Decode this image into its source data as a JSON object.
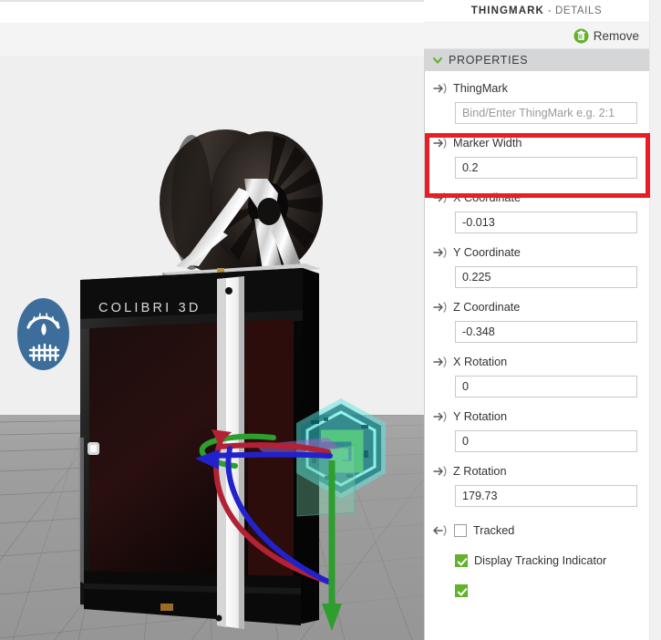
{
  "panel": {
    "title_strong": "THINGMARK",
    "title_sep": " - ",
    "title_light": "DETAILS",
    "remove_label": "Remove",
    "remove_icon": "trash-icon",
    "section": {
      "label": "PROPERTIES",
      "chevron_icon": "chevron-down-icon",
      "expanded": true
    },
    "accent_green": "#62b22c",
    "highlight_color": "#ec1c24",
    "properties": [
      {
        "label": "ThingMark",
        "bind_icon": "arrow-right-binding-icon",
        "value": "",
        "placeholder": "Bind/Enter ThingMark e.g. 2:1",
        "highlighted": false
      },
      {
        "label": "Marker Width",
        "bind_icon": "arrow-right-binding-icon",
        "value": "0.2",
        "placeholder": "",
        "highlighted": true
      },
      {
        "label": "X Coordinate",
        "bind_icon": "arrow-right-binding-icon",
        "value": "-0.013",
        "placeholder": "",
        "highlighted": false
      },
      {
        "label": "Y Coordinate",
        "bind_icon": "arrow-right-binding-icon",
        "value": "0.225",
        "placeholder": "",
        "highlighted": false
      },
      {
        "label": "Z Coordinate",
        "bind_icon": "arrow-right-binding-icon",
        "value": "-0.348",
        "placeholder": "",
        "highlighted": false
      },
      {
        "label": "X Rotation",
        "bind_icon": "arrow-right-binding-icon",
        "value": "0",
        "placeholder": "",
        "highlighted": false
      },
      {
        "label": "Y Rotation",
        "bind_icon": "arrow-right-binding-icon",
        "value": "0",
        "placeholder": "",
        "highlighted": false
      },
      {
        "label": "Z Rotation",
        "bind_icon": "arrow-right-binding-icon",
        "value": "179.73",
        "placeholder": "",
        "highlighted": false
      }
    ],
    "checkboxes": [
      {
        "label": "Tracked",
        "checked": false,
        "bind_icon": "arrow-left-binding-icon",
        "indent": false
      },
      {
        "label": "Display Tracking Indicator",
        "checked": true,
        "bind_icon": "",
        "indent": true
      }
    ]
  },
  "viewport": {
    "name": "3d-scene-viewport",
    "badge": {
      "name": "colibri-gauge-badge",
      "color": "#3d6e9b"
    },
    "printer_logo": "COLIBRI 3D",
    "thingmark_marker": {
      "name": "thingmark-hexagon-marker",
      "fill": "#4fe3d6",
      "inner": "#4fc97f"
    },
    "gizmo": {
      "name": "rotation-translation-gizmo",
      "axis_x_color": "#b22234",
      "axis_y_color": "#2e9e2e",
      "axis_z_color": "#2222cc"
    }
  }
}
